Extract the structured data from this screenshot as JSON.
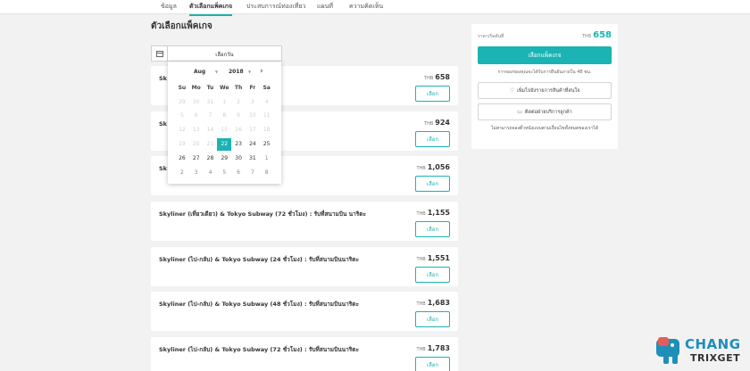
{
  "nav": {
    "tabs": [
      {
        "label": "ข้อมูล"
      },
      {
        "label": "ตัวเลือกแพ็คเกจ"
      },
      {
        "label": "ประสบการณ์ท่องเที่ยว"
      },
      {
        "label": "แผนที่"
      },
      {
        "label": "ความคิดเห็น"
      }
    ],
    "active_index": 1
  },
  "section_title": "ตัวเลือกแพ็คเกจ",
  "date_bar": {
    "label": "เลือกวัน"
  },
  "calendar": {
    "month": "Aug",
    "year": "2018",
    "weekdays": [
      "Su",
      "Mo",
      "Tu",
      "We",
      "Th",
      "Fr",
      "Sa"
    ],
    "weeks": [
      [
        "29",
        "30",
        "31",
        "1",
        "2",
        "3",
        "4"
      ],
      [
        "5",
        "6",
        "7",
        "8",
        "9",
        "10",
        "11"
      ],
      [
        "12",
        "13",
        "14",
        "15",
        "16",
        "17",
        "18"
      ],
      [
        "19",
        "20",
        "21",
        "22",
        "23",
        "24",
        "25"
      ],
      [
        "26",
        "27",
        "28",
        "29",
        "30",
        "31",
        "1"
      ],
      [
        "2",
        "3",
        "4",
        "5",
        "6",
        "7",
        "8"
      ]
    ],
    "selected_day": "22"
  },
  "packages": [
    {
      "title": "Sk",
      "currency": "THB",
      "price": "658",
      "button": "เลือก"
    },
    {
      "title": "Sk                                          (24 ชั่วโมง) : รับที่สนามบิน นา",
      "currency": "THB",
      "price": "924",
      "button": "เลือก"
    },
    {
      "title": "Sk                                          (48 ชั่วโมง) : รับที่สนามบิน นา",
      "currency": "THB",
      "price": "1,056",
      "button": "เลือก"
    },
    {
      "title": "Skyliner (เที่ยวเดียว) & Tokyo Subway (72 ชั่วโมง) : รับที่สนามบิน นาริตะ",
      "currency": "THB",
      "price": "1,155",
      "button": "เลือก"
    },
    {
      "title": "Skyliner (ไป-กลับ) & Tokyo Subway (24 ชั่วโมง) : รับที่สนามบินนาริตะ",
      "currency": "THB",
      "price": "1,551",
      "button": "เลือก"
    },
    {
      "title": "Skyliner (ไป-กลับ) & Tokyo Subway (48 ชั่วโมง) : รับที่สนามบินนาริตะ",
      "currency": "THB",
      "price": "1,683",
      "button": "เลือก"
    },
    {
      "title": "Skyliner (ไป-กลับ) & Tokyo Subway (72 ชั่วโมง) : รับที่สนามบินนาริตะ",
      "currency": "THB",
      "price": "1,783",
      "button": "เลือก"
    }
  ],
  "panel": {
    "price_label": "ราคาเริ่มต้นที่",
    "currency": "THB",
    "price": "658",
    "cta": "เลือกแพ็คเกจ",
    "note": "การจองของคุณจะได้รับการยืนยันภายใน 48 ชม.",
    "wishlist": "เพิ่มไปยังรายการสินค้าที่สนใจ",
    "contact": "ติดต่อฝ่ายบริการลูกค้า",
    "footer": "ไม่สามารถจองตั๋วหนังแบบตามเงื่อนไขทั้งหมดของเราได้"
  },
  "colors": {
    "accent": "#1bb3b3",
    "logo_blue": "#1e8fb8"
  },
  "icons": {
    "calendar": "calendar-icon",
    "heart": "heart-icon",
    "chat": "chat-icon",
    "next": "chevron-right-icon"
  },
  "watermark": {
    "line1": "CHANG",
    "line2": "TRIXGET"
  }
}
